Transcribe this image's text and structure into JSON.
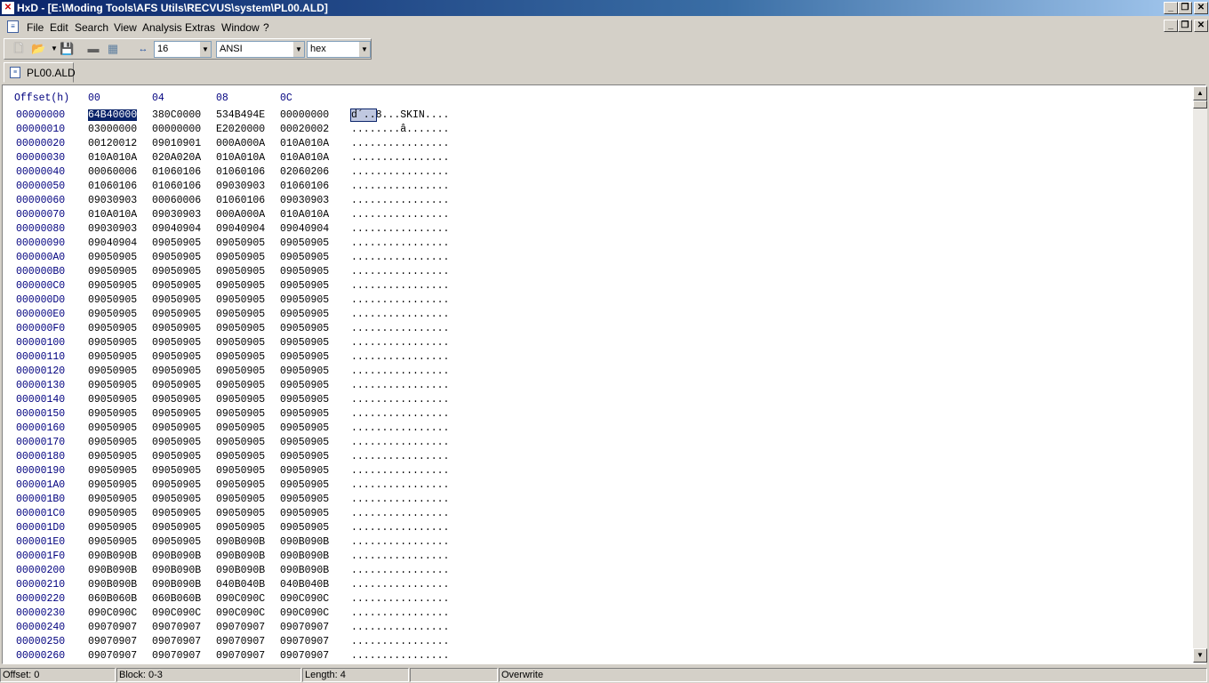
{
  "window": {
    "title": "HxD - [E:\\Moding Tools\\AFS Utils\\RECVUS\\system\\PL00.ALD]",
    "app_icon": "hxd-app-icon",
    "controls": [
      "_",
      "❐",
      "✕"
    ]
  },
  "menu": [
    "File",
    "Edit",
    "Search",
    "View",
    "Analysis",
    "Extras",
    "Window",
    "?"
  ],
  "toolbar": {
    "icons": [
      "new-file-icon",
      "open-file-icon",
      "save-icon",
      "open-disk-icon",
      "open-ram-icon",
      "bytes-per-row-icon"
    ],
    "bytes_per_row": "16",
    "charset": "ANSI",
    "offset_base": "hex"
  },
  "tabs": [
    {
      "label": "PL00.ALD"
    }
  ],
  "hex": {
    "header": {
      "offset": "Offset(h)",
      "cols": [
        "00",
        "04",
        "08",
        "0C"
      ]
    },
    "rows": [
      {
        "offset": "00000000",
        "groups": [
          "64B40000",
          "380C0000",
          "534B494E",
          "00000000"
        ],
        "text_selected": "d´..",
        "text_rest": "8...SKIN...."
      },
      {
        "offset": "00000010",
        "groups": [
          "03000000",
          "00000000",
          "E2020000",
          "00020002"
        ],
        "text": "........â......."
      },
      {
        "offset": "00000020",
        "groups": [
          "00120012",
          "09010901",
          "000A000A",
          "010A010A"
        ],
        "text": "................"
      },
      {
        "offset": "00000030",
        "groups": [
          "010A010A",
          "020A020A",
          "010A010A",
          "010A010A"
        ],
        "text": "................"
      },
      {
        "offset": "00000040",
        "groups": [
          "00060006",
          "01060106",
          "01060106",
          "02060206"
        ],
        "text": "................"
      },
      {
        "offset": "00000050",
        "groups": [
          "01060106",
          "01060106",
          "09030903",
          "01060106"
        ],
        "text": "................"
      },
      {
        "offset": "00000060",
        "groups": [
          "09030903",
          "00060006",
          "01060106",
          "09030903"
        ],
        "text": "................"
      },
      {
        "offset": "00000070",
        "groups": [
          "010A010A",
          "09030903",
          "000A000A",
          "010A010A"
        ],
        "text": "................"
      },
      {
        "offset": "00000080",
        "groups": [
          "09030903",
          "09040904",
          "09040904",
          "09040904"
        ],
        "text": "................"
      },
      {
        "offset": "00000090",
        "groups": [
          "09040904",
          "09050905",
          "09050905",
          "09050905"
        ],
        "text": "................"
      },
      {
        "offset": "000000A0",
        "groups": [
          "09050905",
          "09050905",
          "09050905",
          "09050905"
        ],
        "text": "................"
      },
      {
        "offset": "000000B0",
        "groups": [
          "09050905",
          "09050905",
          "09050905",
          "09050905"
        ],
        "text": "................"
      },
      {
        "offset": "000000C0",
        "groups": [
          "09050905",
          "09050905",
          "09050905",
          "09050905"
        ],
        "text": "................"
      },
      {
        "offset": "000000D0",
        "groups": [
          "09050905",
          "09050905",
          "09050905",
          "09050905"
        ],
        "text": "................"
      },
      {
        "offset": "000000E0",
        "groups": [
          "09050905",
          "09050905",
          "09050905",
          "09050905"
        ],
        "text": "................"
      },
      {
        "offset": "000000F0",
        "groups": [
          "09050905",
          "09050905",
          "09050905",
          "09050905"
        ],
        "text": "................"
      },
      {
        "offset": "00000100",
        "groups": [
          "09050905",
          "09050905",
          "09050905",
          "09050905"
        ],
        "text": "................"
      },
      {
        "offset": "00000110",
        "groups": [
          "09050905",
          "09050905",
          "09050905",
          "09050905"
        ],
        "text": "................"
      },
      {
        "offset": "00000120",
        "groups": [
          "09050905",
          "09050905",
          "09050905",
          "09050905"
        ],
        "text": "................"
      },
      {
        "offset": "00000130",
        "groups": [
          "09050905",
          "09050905",
          "09050905",
          "09050905"
        ],
        "text": "................"
      },
      {
        "offset": "00000140",
        "groups": [
          "09050905",
          "09050905",
          "09050905",
          "09050905"
        ],
        "text": "................"
      },
      {
        "offset": "00000150",
        "groups": [
          "09050905",
          "09050905",
          "09050905",
          "09050905"
        ],
        "text": "................"
      },
      {
        "offset": "00000160",
        "groups": [
          "09050905",
          "09050905",
          "09050905",
          "09050905"
        ],
        "text": "................"
      },
      {
        "offset": "00000170",
        "groups": [
          "09050905",
          "09050905",
          "09050905",
          "09050905"
        ],
        "text": "................"
      },
      {
        "offset": "00000180",
        "groups": [
          "09050905",
          "09050905",
          "09050905",
          "09050905"
        ],
        "text": "................"
      },
      {
        "offset": "00000190",
        "groups": [
          "09050905",
          "09050905",
          "09050905",
          "09050905"
        ],
        "text": "................"
      },
      {
        "offset": "000001A0",
        "groups": [
          "09050905",
          "09050905",
          "09050905",
          "09050905"
        ],
        "text": "................"
      },
      {
        "offset": "000001B0",
        "groups": [
          "09050905",
          "09050905",
          "09050905",
          "09050905"
        ],
        "text": "................"
      },
      {
        "offset": "000001C0",
        "groups": [
          "09050905",
          "09050905",
          "09050905",
          "09050905"
        ],
        "text": "................"
      },
      {
        "offset": "000001D0",
        "groups": [
          "09050905",
          "09050905",
          "09050905",
          "09050905"
        ],
        "text": "................"
      },
      {
        "offset": "000001E0",
        "groups": [
          "09050905",
          "09050905",
          "090B090B",
          "090B090B"
        ],
        "text": "................"
      },
      {
        "offset": "000001F0",
        "groups": [
          "090B090B",
          "090B090B",
          "090B090B",
          "090B090B"
        ],
        "text": "................"
      },
      {
        "offset": "00000200",
        "groups": [
          "090B090B",
          "090B090B",
          "090B090B",
          "090B090B"
        ],
        "text": "................"
      },
      {
        "offset": "00000210",
        "groups": [
          "090B090B",
          "090B090B",
          "040B040B",
          "040B040B"
        ],
        "text": "................"
      },
      {
        "offset": "00000220",
        "groups": [
          "060B060B",
          "060B060B",
          "090C090C",
          "090C090C"
        ],
        "text": "................"
      },
      {
        "offset": "00000230",
        "groups": [
          "090C090C",
          "090C090C",
          "090C090C",
          "090C090C"
        ],
        "text": "................"
      },
      {
        "offset": "00000240",
        "groups": [
          "09070907",
          "09070907",
          "09070907",
          "09070907"
        ],
        "text": "................"
      },
      {
        "offset": "00000250",
        "groups": [
          "09070907",
          "09070907",
          "09070907",
          "09070907"
        ],
        "text": "................"
      },
      {
        "offset": "00000260",
        "groups": [
          "09070907",
          "09070907",
          "09070907",
          "09070907"
        ],
        "text": "................"
      }
    ]
  },
  "status": {
    "offset": "Offset: 0",
    "block": "Block: 0-3",
    "length": "Length: 4",
    "blank": "",
    "mode": "Overwrite"
  },
  "colors": {
    "offset_text": "#00007f",
    "selection": "#0a246a",
    "title_gradient_start": "#0a246a"
  }
}
